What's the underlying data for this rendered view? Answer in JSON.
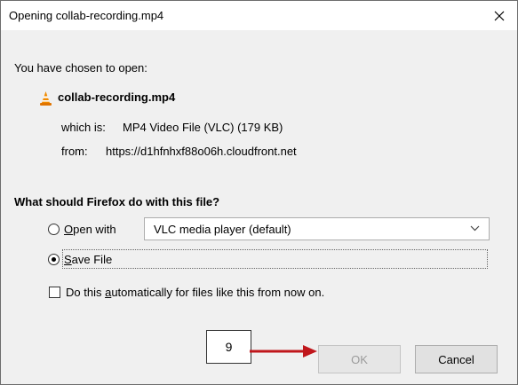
{
  "dialog": {
    "title": "Opening collab-recording.mp4",
    "close_glyph": "✕"
  },
  "file_info": {
    "intro": "You have chosen to open:",
    "icon": "vlc-cone-icon",
    "file_name": "collab-recording.mp4",
    "which_label": "which is:",
    "which_value": "MP4 Video File (VLC) (179 KB)",
    "from_label": "from:",
    "from_value": "https://d1hfnhxf88o06h.cloudfront.net"
  },
  "question": "What should Firefox do with this file?",
  "open_with": {
    "label_mnemonic": "O",
    "label_rest": "pen with",
    "selected": false,
    "app": "VLC media player (default)"
  },
  "save_file": {
    "label_mnemonic": "S",
    "label_rest": "ave File",
    "selected": true
  },
  "auto": {
    "label_before": "Do this ",
    "label_mnemonic": "a",
    "label_after": "utomatically for files like this from now on.",
    "checked": false
  },
  "buttons": {
    "ok": "OK",
    "cancel": "Cancel"
  },
  "annotation": {
    "step_number": "9",
    "arrow_color": "#c0171c"
  }
}
